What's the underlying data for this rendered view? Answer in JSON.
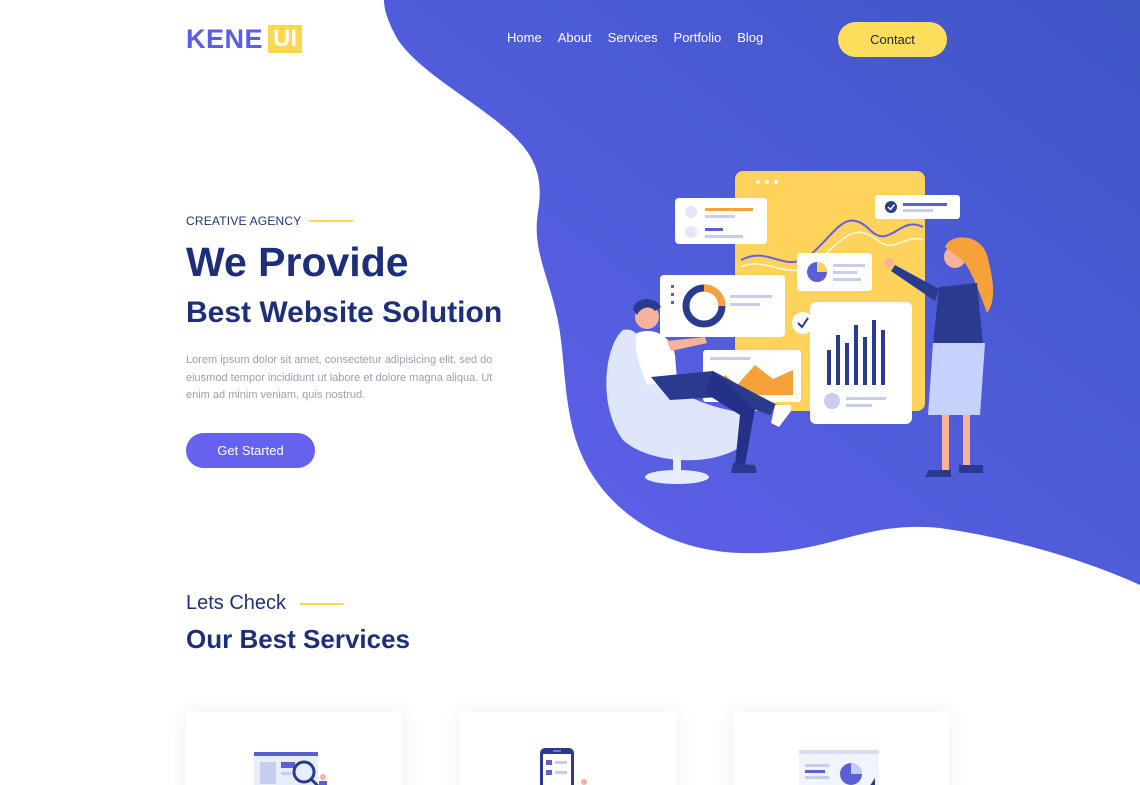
{
  "brand": {
    "name_main": "KENE",
    "name_box": "UI"
  },
  "nav": {
    "items": [
      {
        "label": "Home"
      },
      {
        "label": "About"
      },
      {
        "label": "Services"
      },
      {
        "label": "Portfolio"
      },
      {
        "label": "Blog"
      }
    ],
    "contact_label": "Contact"
  },
  "hero": {
    "eyebrow": "CREATIVE AGENCY",
    "title": "We Provide",
    "subtitle": "Best Website Solution",
    "description": "Lorem ipsum dolor sit amet, consectetur adipisicing elit, sed do eiusmod tempor incididunt ut labore et dolore magna aliqua. Ut enim ad minim veniam, quis nostrud.",
    "cta_label": "Get Started"
  },
  "services": {
    "eyebrow": "Lets Check",
    "title": "Our Best Services",
    "cards": [
      {
        "icon": "browser-search-icon"
      },
      {
        "icon": "mobile-app-icon"
      },
      {
        "icon": "analytics-chart-icon"
      }
    ]
  },
  "colors": {
    "primary": "#5b5ce8",
    "accent_yellow": "#fdd84f",
    "navy": "#1e2f7a",
    "muted_text": "#9aa0b2",
    "hero_gradient_start": "#5f60ec",
    "hero_gradient_end": "#3e56c6"
  }
}
